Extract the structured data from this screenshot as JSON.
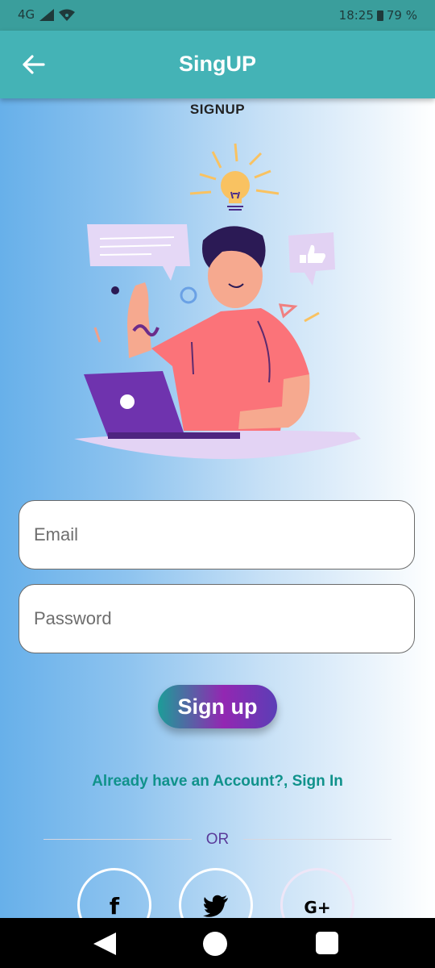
{
  "status_bar": {
    "network": "4G",
    "time": "18:25",
    "battery": "79 %"
  },
  "app_bar": {
    "title": "SingUP",
    "back_icon": "arrow-left-icon"
  },
  "screen": {
    "heading": "SIGNUP"
  },
  "form": {
    "email_placeholder": "Email",
    "email_value": "",
    "password_placeholder": "Password",
    "password_value": "",
    "submit_label": "Sign up"
  },
  "signin_link": "Already have an Account?, Sign In",
  "divider_text": "OR",
  "social": [
    {
      "name": "facebook",
      "glyph": "f",
      "icon": "facebook-icon"
    },
    {
      "name": "twitter",
      "glyph": "",
      "icon": "twitter-icon"
    },
    {
      "name": "google",
      "glyph": "G+",
      "icon": "google-plus-icon"
    }
  ],
  "colors": {
    "status_bar": "#3a9e9c",
    "app_bar": "#44b3b6",
    "link": "#10928b",
    "button_gradient_start": "#1c9d98",
    "button_gradient_mid": "#9327b2",
    "button_gradient_end": "#5b3eb6"
  }
}
